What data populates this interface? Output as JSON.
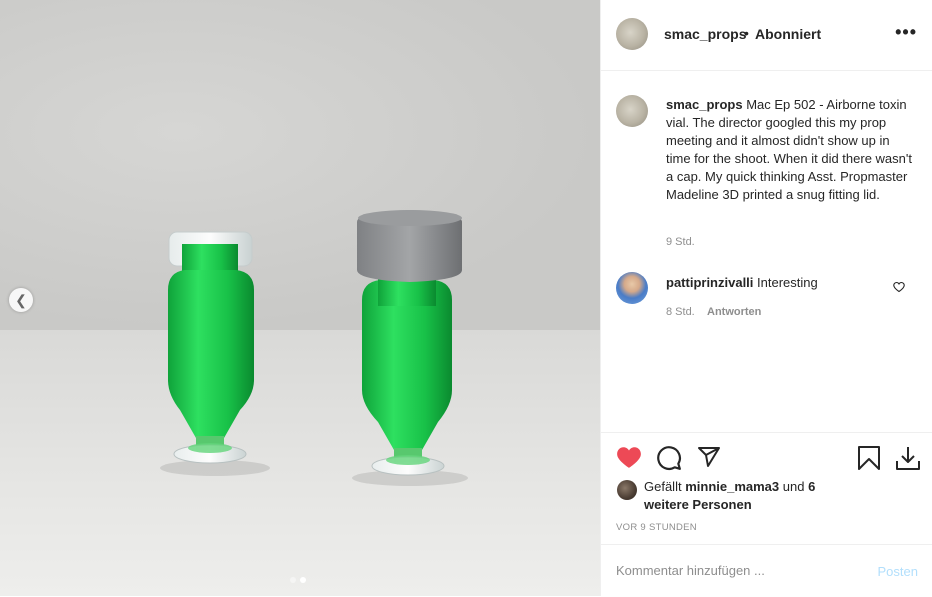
{
  "post": {
    "username": "smac_props",
    "separator": "•",
    "follow_label": "Abonniert",
    "more_label": "•••"
  },
  "caption": {
    "username": "smac_props",
    "text": "Mac Ep 502 - Airborne toxin vial. The director googled this my prop meeting and it almost didn't show up in time for the shoot. When it did there wasn't a cap. My quick thinking Asst. Propmaster Madeline 3D printed a snug fitting lid.",
    "time": "9 Std."
  },
  "comments": [
    {
      "username": "pattiprinzivalli",
      "text": "Interesting",
      "time": "8 Std.",
      "reply_label": "Antworten"
    }
  ],
  "likes": {
    "prefix": "Gefällt",
    "user": "minnie_mama3",
    "connector": "und",
    "others": "6 weitere Personen"
  },
  "post_time": "VOR 9 STUNDEN",
  "add_comment": {
    "placeholder": "Kommentar hinzufügen ...",
    "post_label": "Posten"
  },
  "carousel": {
    "prev_icon": "chevron-left-icon",
    "total": 2,
    "current": 2
  },
  "colors": {
    "like_red": "#ed4956",
    "vial_green": "#1fc44a",
    "cap_gray": "#8d8f91",
    "post_button": "#b2dffc"
  }
}
